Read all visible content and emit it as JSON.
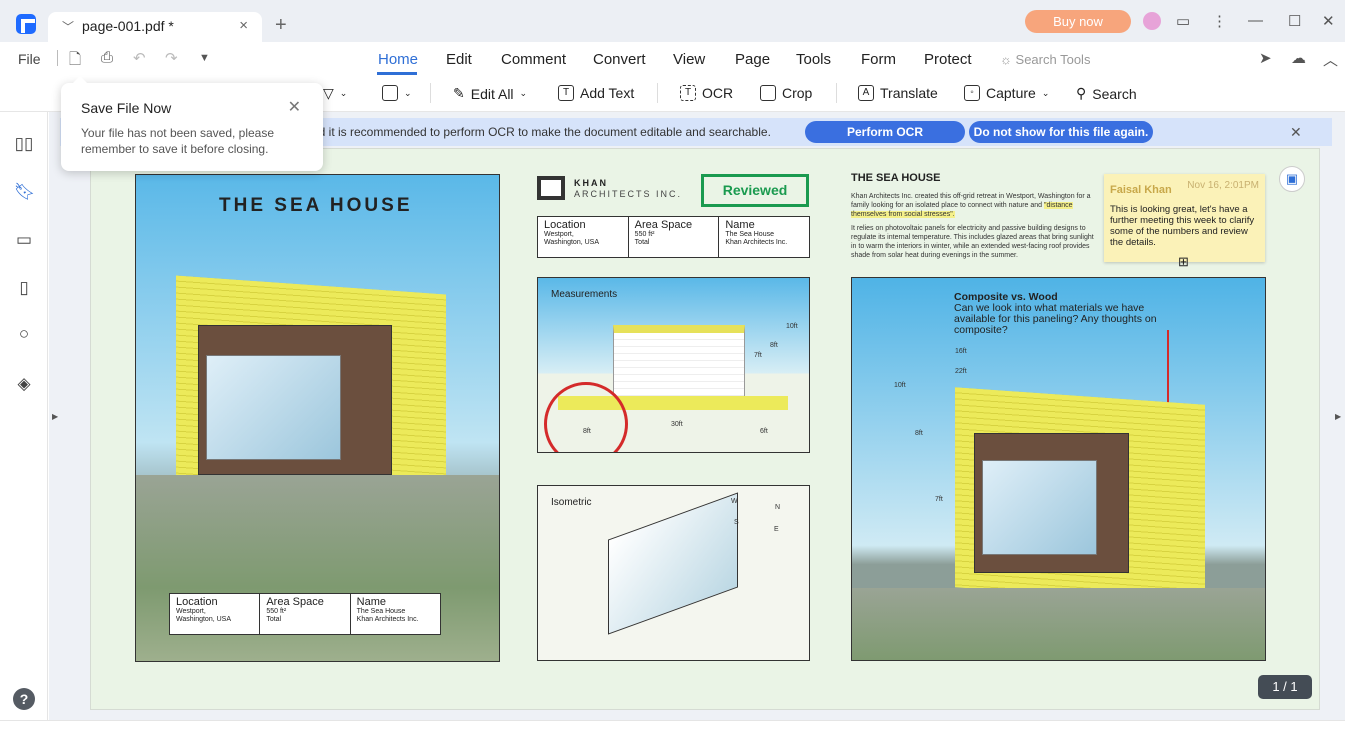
{
  "tab": {
    "title": "page-001.pdf *"
  },
  "buy_label": "Buy now",
  "menu": [
    "File",
    "Home",
    "Edit",
    "Comment",
    "Convert",
    "View",
    "Page",
    "Tools",
    "Form",
    "Protect"
  ],
  "search_tools": "Search Tools",
  "toolbar": {
    "edit_all": "Edit All",
    "add_text": "Add Text",
    "ocr": "OCR",
    "crop": "Crop",
    "translate": "Translate",
    "capture": "Capture",
    "search": "Search"
  },
  "popup": {
    "title": "Save File Now",
    "body": "Your file has not been saved, please remember to save it before closing."
  },
  "ocr_banner": {
    "text": "nd it is recommended to perform OCR to make the document editable and searchable.",
    "perform": "Perform OCR",
    "dismiss": "Do not show for this file again."
  },
  "doc": {
    "title": "THE SEA HOUSE",
    "info": [
      {
        "h": "Location",
        "v": "Westport,\nWashington, USA"
      },
      {
        "h": "Area Space",
        "v": "550 ft²\nTotal"
      },
      {
        "h": "Name",
        "v": "The Sea House\nKhan Architects Inc."
      }
    ],
    "brand_top": "KHAN",
    "brand_bottom": "ARCHITECTS INC.",
    "stamp": "Reviewed",
    "measurements": "Measurements",
    "isometric": "Isometric",
    "dims": [
      "10ft",
      "8ft",
      "7ft",
      "8ft",
      "30ft",
      "6ft"
    ],
    "compass": [
      "W",
      "N",
      "S",
      "E"
    ],
    "heading2": "THE SEA HOUSE",
    "para1a": "Khan Architects Inc. created this off-grid retreat in Westport, Washington for a family looking for an isolated place to connect with nature and ",
    "para1b": "\"distance themselves from social stresses\".",
    "para2": "It relies on photovoltaic panels for electricity and passive building designs to regulate its internal temperature. This includes glazed areas that bring sunlight in to warm the interiors in winter, while an extended west-facing roof provides shade from solar heat during evenings in the summer.",
    "callout_title": "Composite vs. Wood",
    "callout_body": "Can we look into what materials we have available for this paneling? Any thoughts on composite?",
    "right_dims": [
      "16ft",
      "22ft",
      "10ft",
      "8ft",
      "7ft"
    ]
  },
  "note": {
    "author": "Faisal Khan",
    "date": "Nov 16, 2:01PM",
    "text": "This is looking great, let's have a further meeting this week to clarify some of the numbers and review the details."
  },
  "page_count": "1 / 1",
  "colors": {
    "accent": "#2f6fd6",
    "buy": "#f7a57c",
    "ocr_button": "#3a6fe0",
    "stamp": "#1a9a4f",
    "note": "#fbf2b8"
  }
}
